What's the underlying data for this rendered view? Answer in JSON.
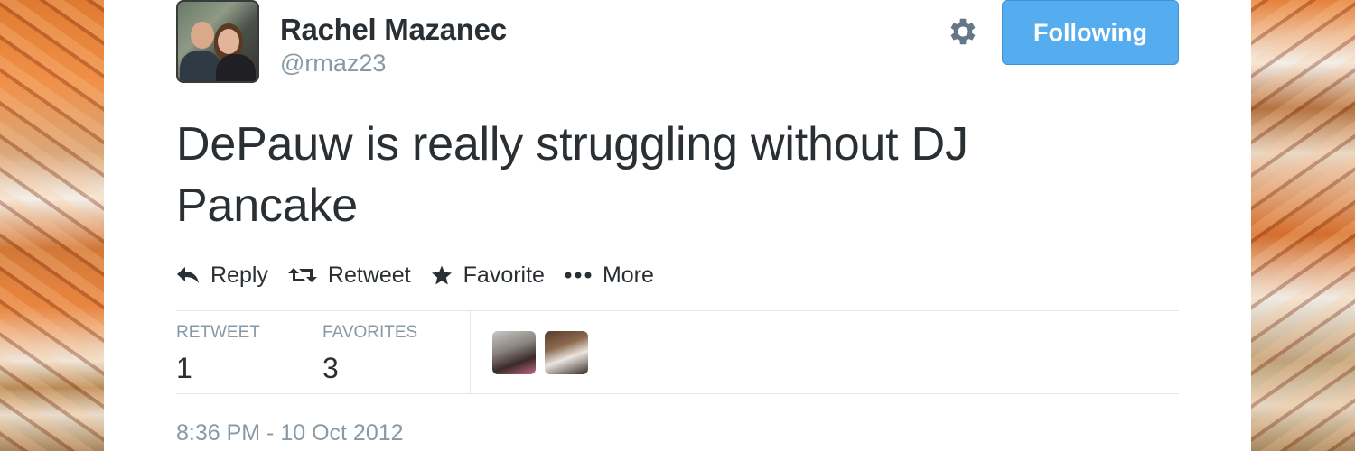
{
  "user": {
    "display_name": "Rachel Mazanec",
    "screen_name": "@rmaz23"
  },
  "follow_button": {
    "label": "Following"
  },
  "tweet": {
    "text": "DePauw is really struggling without DJ Pancake",
    "timestamp": "8:36 PM - 10 Oct 2012"
  },
  "actions": [
    {
      "label": "Reply",
      "icon": "reply-icon"
    },
    {
      "label": "Retweet",
      "icon": "retweet-icon"
    },
    {
      "label": "Favorite",
      "icon": "star-icon"
    },
    {
      "label": "More",
      "icon": "more-dots-icon"
    }
  ],
  "stats": {
    "retweet_label": "RETWEET",
    "retweet_count": "1",
    "favorites_label": "FAVORITES",
    "favorites_count": "3"
  },
  "colors": {
    "accent": "#55acee",
    "text": "#292f33",
    "muted": "#8899a6",
    "divider": "#e1e8ed"
  }
}
